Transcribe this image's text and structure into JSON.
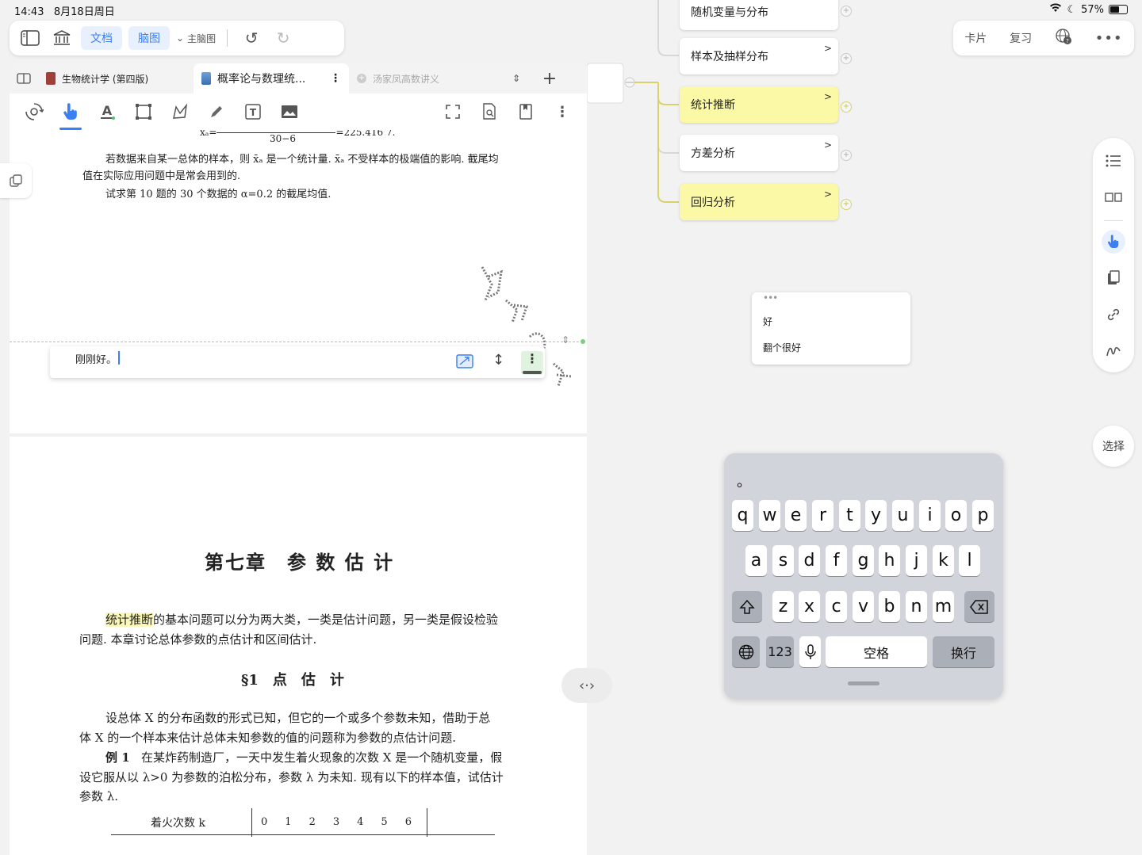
{
  "status": {
    "time": "14:43",
    "date": "8月18日周日",
    "battery": "57%"
  },
  "topbar": {
    "tab_doc": "文档",
    "tab_mindmap": "脑图",
    "dropdown_label": "主脑图"
  },
  "rightbar": {
    "card": "卡片",
    "review": "复习"
  },
  "tabs": [
    {
      "label": "生物统计学 (第四版)"
    },
    {
      "label": "概率论与数理统..."
    },
    {
      "label": "汤家凤高数讲义"
    }
  ],
  "doc": {
    "formula_frag": "x̄ₐ=",
    "formula_denom": "30−6",
    "formula_result": "=225.416 7.",
    "para1_line1": "若数据来自某一总体的样本，则 x̄ₐ 是一个统计量. x̄ₐ 不受样本的极端值的影响. 截尾均",
    "para1_line2": "值在实际应用问题中是常会用到的.",
    "para2": "试求第 10 题的 30 个数据的 α=0.2 的截尾均值.",
    "note_text": "刚刚好。",
    "chapter_title": "第七章　参 数 估 计",
    "intro_hl": "统计推断",
    "intro_rest": "的基本问题可以分为两大类，一类是估计问题，另一类是假设检验",
    "intro_line2": "问题. 本章讨论总体参数的点估计和区间估计.",
    "section_title": "§1　点　估　计",
    "p3_line1": "设总体 X 的分布函数的形式已知，但它的一个或多个参数未知，借助于总",
    "p3_line2": "体 X 的一个样本来估计总体未知参数的值的问题称为参数的点估计问题.",
    "ex_label": "例 1",
    "ex_line1": "在某炸药制造厂，一天中发生着火现象的次数 X 是一个随机变量，假",
    "ex_line2": "设它服从以 λ>0 为参数的泊松分布，参数 λ 为未知. 现有以下的样本值，试估计",
    "ex_line3": "参数 λ.",
    "table_header": "着火次数 k",
    "table_values": [
      "0",
      "1",
      "2",
      "3",
      "4",
      "5",
      "6"
    ]
  },
  "mindmap": {
    "nodes": [
      {
        "label": "随机变量与分布",
        "highlight": false
      },
      {
        "label": "样本及抽样分布",
        "highlight": false
      },
      {
        "label": "统计推断",
        "highlight": true
      },
      {
        "label": "方差分析",
        "highlight": false
      },
      {
        "label": "回归分析",
        "highlight": true
      }
    ]
  },
  "card": {
    "line1": "好",
    "line2": "翻个很好"
  },
  "select_label": "选择",
  "keyboard": {
    "suggestion": "。",
    "row1": [
      "q",
      "w",
      "e",
      "r",
      "t",
      "y",
      "u",
      "i",
      "o",
      "p"
    ],
    "row2": [
      "a",
      "s",
      "d",
      "f",
      "g",
      "h",
      "j",
      "k",
      "l"
    ],
    "row3": [
      "z",
      "x",
      "c",
      "v",
      "b",
      "n",
      "m"
    ],
    "numbers": "123",
    "space": "空格",
    "return": "换行"
  },
  "colors": {
    "accent": "#3b7ff5",
    "highlight": "#fbf8a6"
  }
}
